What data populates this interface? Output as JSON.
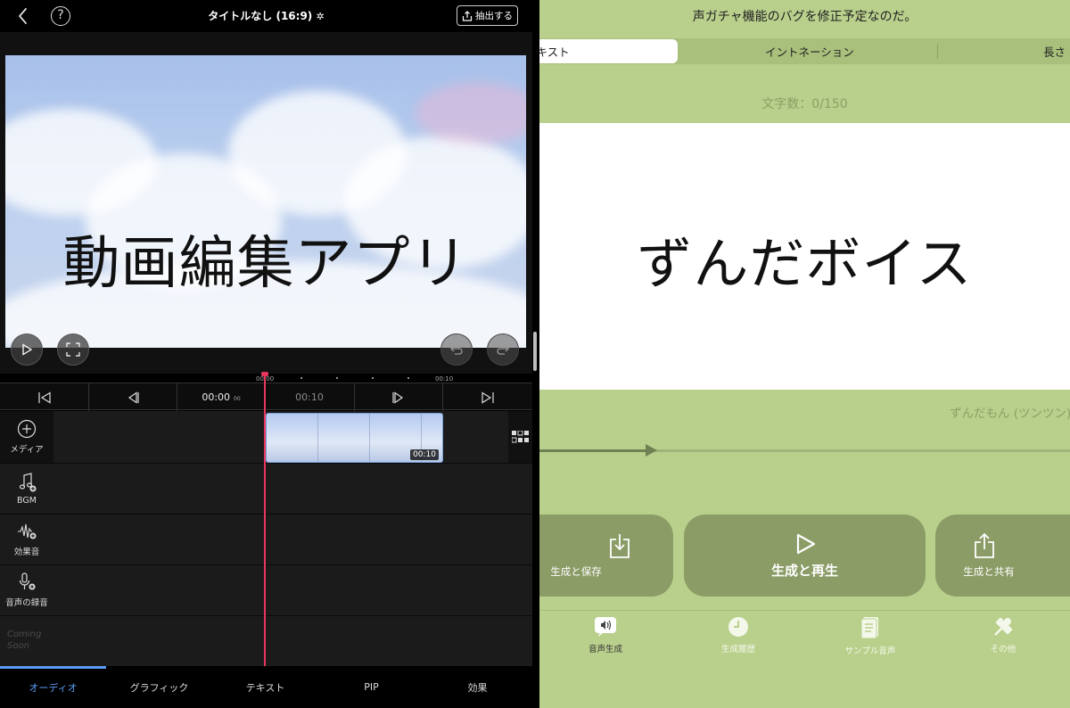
{
  "editor": {
    "project_title": "タイトルなし (16:9)",
    "extract_label": "抽出する",
    "help_glyph": "?",
    "preview_text": "動画編集アプリ",
    "ruler": {
      "start": "00:00",
      "end": "00:10"
    },
    "timecode_current": "00:00",
    "timecode_frames": "00",
    "timecode_end": "00:10",
    "clip_duration": "00:10",
    "tracks": [
      {
        "label": "メディア",
        "icon": "plus-circle-icon"
      },
      {
        "label": "BGM",
        "icon": "music-note-icon"
      },
      {
        "label": "効果音",
        "icon": "waveform-icon"
      },
      {
        "label": "音声の録音",
        "icon": "microphone-icon"
      }
    ],
    "coming_soon_line1": "Coming",
    "coming_soon_line2": "Soon",
    "bottom_tabs": [
      "オーディオ",
      "グラフィック",
      "テキスト",
      "PIP",
      "効果"
    ],
    "active_tab": "オーディオ",
    "accent_color": "#5b9cf5",
    "playhead_color": "#e8375c"
  },
  "voice": {
    "notice": "声ガチャ機能のバグを修正予定なのだ。",
    "segments": [
      "テキスト",
      "イントネーション",
      "長さ"
    ],
    "active_segment": "テキスト",
    "char_count": "文字数：0/150",
    "main_text": "ずんだボイス",
    "speaker": "ずんだもん (ツンツン)",
    "speed_fraction": 0.2,
    "actions": [
      {
        "label": "生成と保存",
        "icon": "download-icon"
      },
      {
        "label": "生成と再生",
        "icon": "play-icon"
      },
      {
        "label": "生成と共有",
        "icon": "share-icon"
      }
    ],
    "tabs": [
      {
        "label": "音声生成",
        "icon": "speaker-icon"
      },
      {
        "label": "生成履歴",
        "icon": "clock-icon"
      },
      {
        "label": "サンプル音声",
        "icon": "document-icon"
      },
      {
        "label": "その他",
        "icon": "tools-icon"
      }
    ],
    "active_tab": "音声生成",
    "background_color": "#b9d08c",
    "button_color": "#8b9c66"
  }
}
